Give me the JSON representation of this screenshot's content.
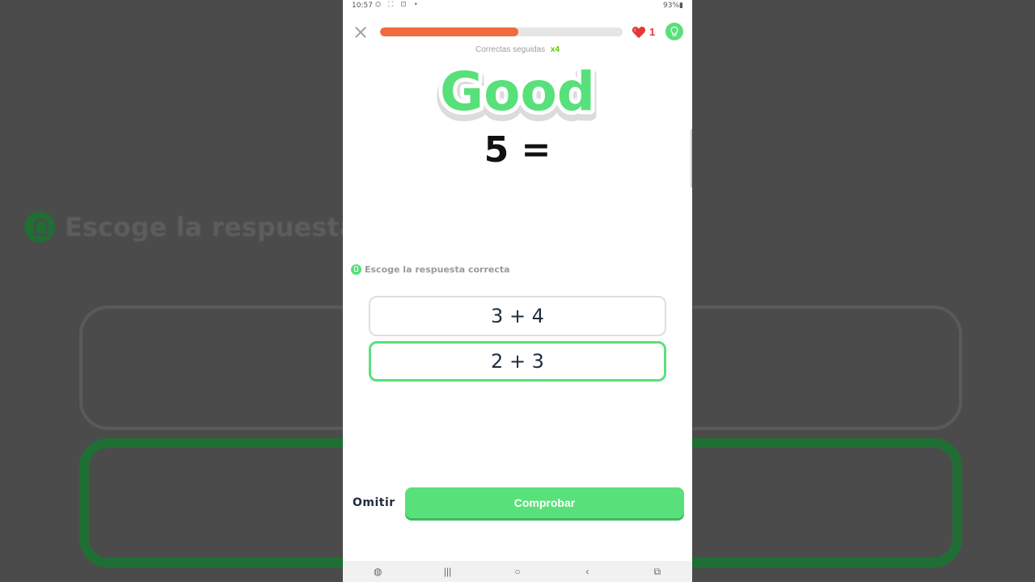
{
  "background": {
    "prompt_text": "Escoge la respuesta"
  },
  "status_bar": {
    "time": "10:57",
    "left_icons": "⛭ ⛶ ⊡ •",
    "right_text": "93%▮"
  },
  "header": {
    "progress_percent": 57,
    "lives": "1",
    "colors": {
      "progress": "#ee6c3f",
      "heart": "#e53935",
      "accent": "#58e07a"
    }
  },
  "streak": {
    "label": "Correctas seguidas",
    "count": "x4"
  },
  "banner": {
    "text": "Good"
  },
  "question": {
    "equation": "5 ="
  },
  "prompt": {
    "text": "Escoge la respuesta correcta"
  },
  "options": [
    {
      "label": "3 + 4",
      "selected": false
    },
    {
      "label": "2 + 3",
      "selected": true
    }
  ],
  "footer": {
    "skip_label": "Omitir",
    "check_label": "Comprobar"
  },
  "navbar": {
    "items": [
      "◍",
      "|||",
      "○",
      "‹",
      "⧉"
    ]
  }
}
